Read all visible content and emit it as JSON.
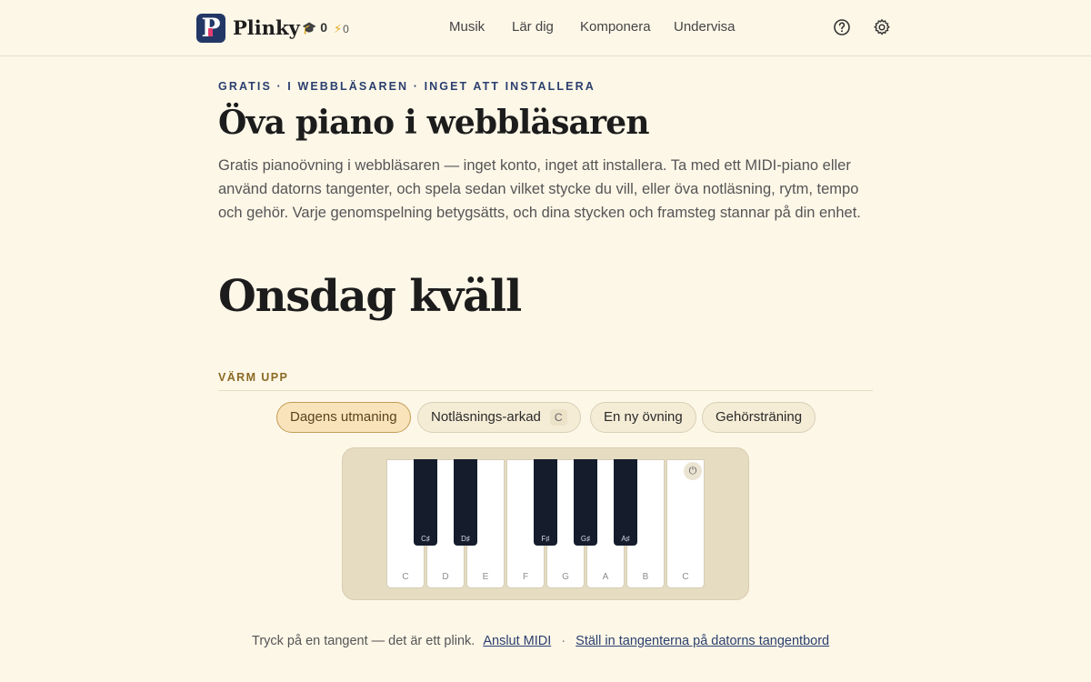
{
  "header": {
    "brand": "Plinky",
    "logo_letter": "P",
    "stats": {
      "graduation": "0",
      "lightning": "0"
    },
    "nav": [
      "Musik",
      "Lär dig",
      "Komponera",
      "Undervisa"
    ],
    "icons": [
      "help-icon",
      "gear-icon"
    ]
  },
  "hero": {
    "eyebrow": "GRATIS · I WEBBLÄSAREN · INGET ATT INSTALLERA",
    "title": "Öva piano i webbläsaren",
    "lead": "Gratis pianoövning i webbläsaren — inget konto, inget att installera. Ta med ett MIDI-piano eller använd datorns tangenter, och spela sedan vilket stycke du vill, eller öva notläsning, rytm, tempo och gehör. Varje genomspelning betygsätts, och dina stycken och framsteg stannar på din enhet."
  },
  "greeting": "Onsdag kväll",
  "warmup": {
    "label": "VÄRM UPP",
    "chips": [
      {
        "label": "Dagens utmaning",
        "active": true
      },
      {
        "label": "Notläsnings-arkad",
        "key": "C"
      },
      {
        "label": "En ny övning"
      },
      {
        "label": "Gehörsträning"
      }
    ]
  },
  "piano": {
    "white_keys": [
      "C",
      "D",
      "E",
      "F",
      "G",
      "A",
      "B",
      "C"
    ],
    "black_keys": [
      "C♯",
      "D♯",
      "F♯",
      "G♯",
      "A♯"
    ],
    "plug_icon": "plug-icon"
  },
  "hint": {
    "text": "Tryck på en tangent — det är ett plink.",
    "midi_link": "Anslut MIDI",
    "separator": "·",
    "keyboard_link": "Ställ in tangenterna på datorns tangentbord"
  },
  "colors": {
    "background": "#fdf7e8",
    "accent": "#233766",
    "key_black": "#151c2c"
  }
}
